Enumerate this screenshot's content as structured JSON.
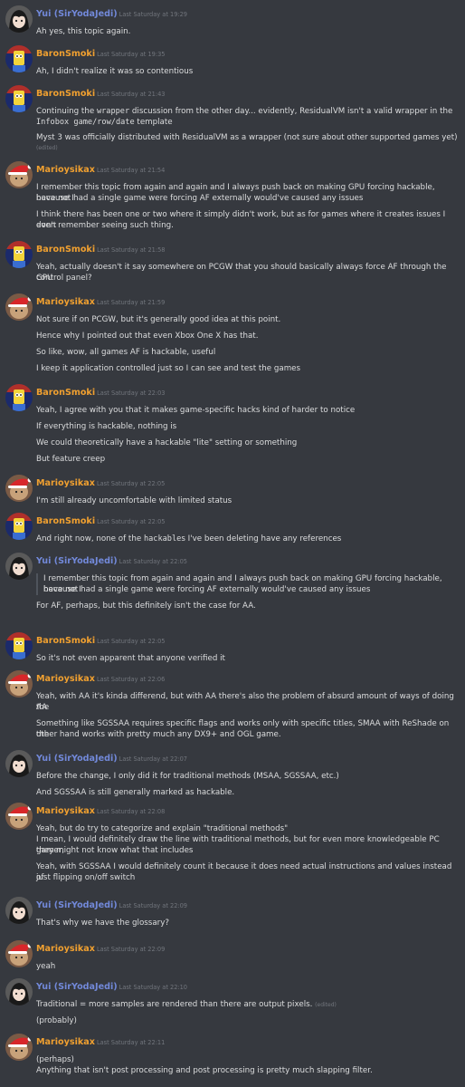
{
  "colors": {
    "yui": "#7289da",
    "baron": "#f0a030",
    "mario": "#f0a030"
  },
  "icons": {
    "yui": "dark-haired-girl-avatar-icon",
    "baron": "yellow-cartoon-character-avatar-icon",
    "mario": "santa-hat-avatar-icon"
  },
  "messages": [
    {
      "user": "Yui (SirYodaJedi)",
      "who": "yui",
      "time": "Last Saturday at 19:29",
      "lines": [
        {
          "t": "Ah yes, this topic again."
        }
      ]
    },
    {
      "user": "BaronSmoki",
      "who": "baron",
      "time": "Last Saturday at 19:35",
      "lines": [
        {
          "t": "Ah, I didn't realize it was so contentious"
        }
      ]
    },
    {
      "user": "BaronSmoki",
      "who": "baron",
      "time": "Last Saturday at 21:43",
      "lines": [
        {
          "parts": [
            {
              "t": "Continuing the "
            },
            {
              "c": "wrapper"
            },
            {
              "t": " discussion from the other day... evidently, ResidualVM isn't a valid wrapper in the "
            }
          ]
        },
        {
          "parts": [
            {
              "c": "Infobox game/row/date"
            },
            {
              "t": " template"
            }
          ]
        },
        {
          "t": "Myst 3 was officially distributed with ResidualVM as a wrapper (not sure about other supported games yet)"
        },
        {
          "e": "(edited)"
        }
      ]
    },
    {
      "user": "Marioysikax",
      "who": "mario",
      "time": "Last Saturday at 21:54",
      "lines": [
        {
          "t": "I remember this topic from again and again and I always push back on making GPU forcing hackable, because I"
        },
        {
          "t": "have not had a single game were forcing AF externally would've caused any issues"
        },
        {
          "t": "I think there has been one or two where it simply didn't work, but as for games where it creates issues I don't"
        },
        {
          "t": "even remember seeing such thing."
        }
      ]
    },
    {
      "user": "BaronSmoki",
      "who": "baron",
      "time": "Last Saturday at 21:58",
      "lines": [
        {
          "t": "Yeah, actually doesn't it say somewhere on PCGW that you should basically always force AF through the GPU"
        },
        {
          "t": "control panel?"
        }
      ]
    },
    {
      "user": "Marioysikax",
      "who": "mario",
      "time": "Last Saturday at 21:59",
      "lines": [
        {
          "t": "Not sure if on PCGW, but it's generally good idea at this point."
        },
        {
          "t": "Hence why I pointed out that even Xbox One X has that."
        },
        {
          "t": "So like, wow, all games AF is hackable, useful"
        },
        {
          "t": "I keep it application controlled just so I can see and test the games"
        }
      ]
    },
    {
      "user": "BaronSmoki",
      "who": "baron",
      "time": "Last Saturday at 22:03",
      "lines": [
        {
          "t": "Yeah, I agree with you that it makes game-specific hacks kind of harder to notice"
        },
        {
          "t": "If everything is hackable, nothing is"
        },
        {
          "t": "We could theoretically have a hackable \"lite\" setting or something"
        },
        {
          "t": "But feature creep"
        }
      ]
    },
    {
      "user": "Marioysikax",
      "who": "mario",
      "time": "Last Saturday at 22:05",
      "lines": [
        {
          "t": "I'm still already uncomfortable with limited status"
        }
      ]
    },
    {
      "user": "BaronSmoki",
      "who": "baron",
      "time": "Last Saturday at 22:05",
      "lines": [
        {
          "parts": [
            {
              "t": "And right now, none of the "
            },
            {
              "c": "hackable"
            },
            {
              "t": "s I've been deleting have any references"
            }
          ]
        }
      ]
    },
    {
      "user": "Yui (SirYodaJedi)",
      "who": "yui",
      "time": "Last Saturday at 22:05",
      "lines": [
        {
          "q": "I remember this topic from again and again and I always push back on making GPU forcing hackable, because I"
        },
        {
          "q": "have not had a single game were forcing AF externally would've caused any issues"
        },
        {
          "t": "For AF, perhaps, but this definitely isn't the case for AA."
        }
      ]
    },
    {
      "user": "BaronSmoki",
      "who": "baron",
      "time": "Last Saturday at 22:05",
      "lines": [
        {
          "t": "So it's not even apparent that anyone verified it"
        }
      ]
    },
    {
      "user": "Marioysikax",
      "who": "mario",
      "time": "Last Saturday at 22:06",
      "lines": [
        {
          "t": "Yeah, with AA it's kinda differend, but with AA there's also the problem of absurd amount of ways of doing the"
        },
        {
          "t": "AA"
        },
        {
          "t": "Something like SGSSAA requires specific flags and works only with specific titles, SMAA with ReShade on the"
        },
        {
          "t": "other hand works with pretty much any DX9+ and OGL game."
        }
      ]
    },
    {
      "user": "Yui (SirYodaJedi)",
      "who": "yui",
      "time": "Last Saturday at 22:07",
      "lines": [
        {
          "t": "Before the change, I only did it for traditional methods (MSAA, SGSSAA, etc.)"
        },
        {
          "t": "And SGSSAA is still generally marked as hackable."
        }
      ]
    },
    {
      "user": "Marioysikax",
      "who": "mario",
      "time": "Last Saturday at 22:08",
      "lines": [
        {
          "t": "Yeah, but do try to categorize and explain \"traditional methods\""
        },
        {
          "t": "I mean, I would definitely draw the line with traditional methods, but for even more knowledgeable PC gamer,"
        },
        {
          "t": "they might not know what that includes"
        },
        {
          "t": "Yeah, with SGSSAA I would definitely count it because it does need actual instructions and values instead of"
        },
        {
          "t": "just flipping on/off switch"
        }
      ]
    },
    {
      "user": "Yui (SirYodaJedi)",
      "who": "yui",
      "time": "Last Saturday at 22:09",
      "lines": [
        {
          "t": "That's why we have the glossary?"
        }
      ]
    },
    {
      "user": "Marioysikax",
      "who": "mario",
      "time": "Last Saturday at 22:09",
      "lines": [
        {
          "t": "yeah"
        }
      ]
    },
    {
      "user": "Yui (SirYodaJedi)",
      "who": "yui",
      "time": "Last Saturday at 22:10",
      "lines": [
        {
          "parts": [
            {
              "t": "Traditional = more samples are rendered than there are output pixels. "
            },
            {
              "e": "(edited)"
            }
          ]
        },
        {
          "t": "(probably)"
        }
      ]
    },
    {
      "user": "Marioysikax",
      "who": "mario",
      "time": "Last Saturday at 22:11",
      "lines": [
        {
          "t": "(perhaps)"
        },
        {
          "t": "Anything that isn't post processing and post processing is pretty much slapping filter."
        }
      ]
    }
  ]
}
